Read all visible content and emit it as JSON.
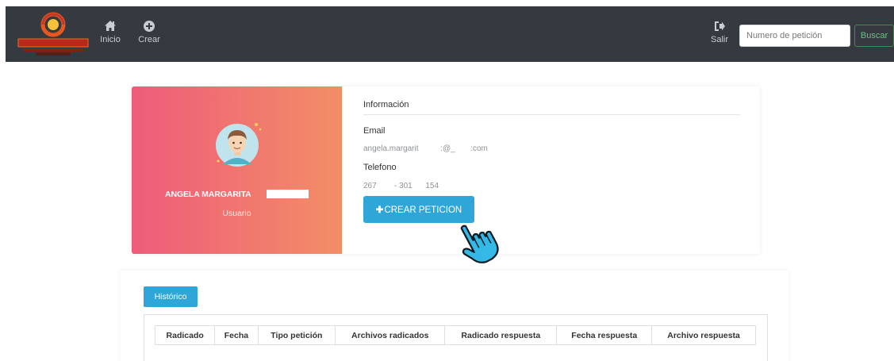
{
  "nav": {
    "inicio_label": "Inicio",
    "crear_label": "Crear",
    "salir_label": "Salir",
    "search_placeholder": "Numero de petición",
    "search_button": "Buscar"
  },
  "profile": {
    "name": "ANGELA MARGARITA",
    "role": "Usuario",
    "info_title": "Información",
    "email_label": "Email",
    "email_value": "angela.margarit          :@_       :com",
    "phone_label": "Telefono",
    "phone_value": "267        - 301      154",
    "create_button": "CREAR PETICION"
  },
  "history": {
    "tab_label": "Histórico",
    "columns": [
      "Radicado",
      "Fecha",
      "Tipo petición",
      "Archivos radicados",
      "Radicado respuesta",
      "Fecha respuesta",
      "Archivo respuesta"
    ]
  },
  "colors": {
    "navbar": "#353a40",
    "accent": "#2fa6d8",
    "gradient_start": "#ee5c7a",
    "gradient_end": "#f28e66",
    "search_button_border": "#3d8b52"
  }
}
